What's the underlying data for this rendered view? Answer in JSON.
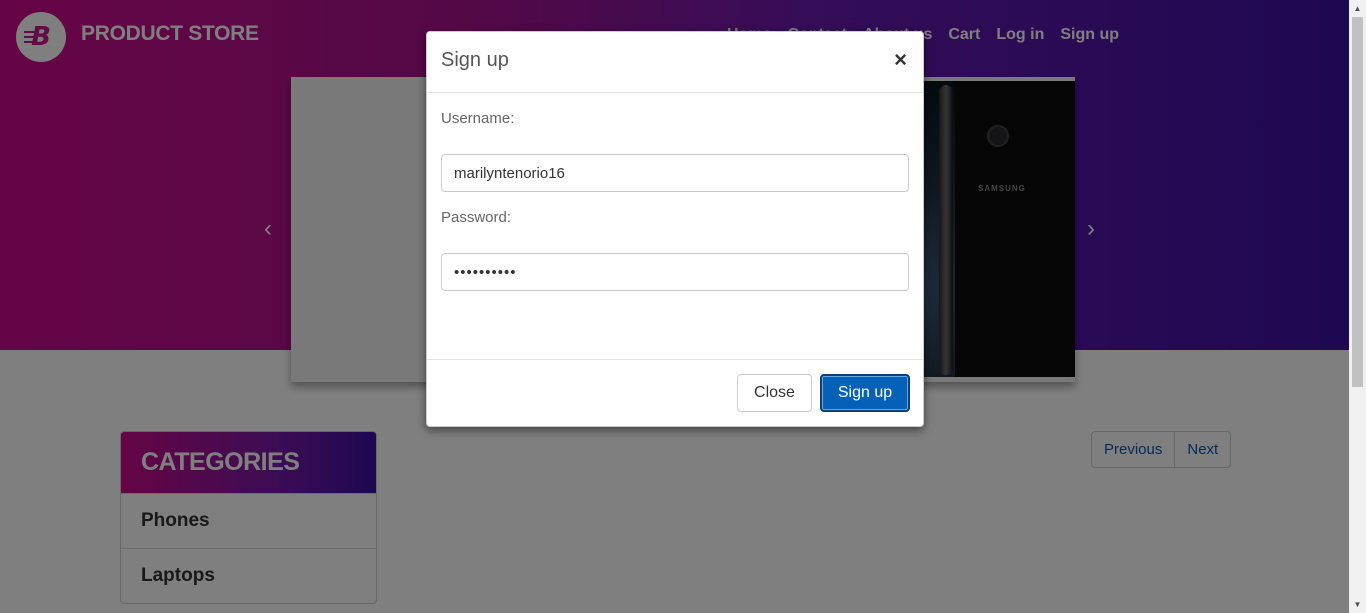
{
  "navbar": {
    "brand_name": "PRODUCT STORE",
    "brand_logo_letter": "B",
    "links": [
      "Home",
      "Contact",
      "About us",
      "Cart",
      "Log in",
      "Sign up"
    ]
  },
  "carousel": {
    "phone_brand": "SAMSUNG",
    "prev_icon": "‹",
    "next_icon": "›"
  },
  "categories": {
    "header": "CATEGORIES",
    "items": [
      "Phones",
      "Laptops"
    ]
  },
  "pagination": {
    "previous": "Previous",
    "next": "Next"
  },
  "modal": {
    "title": "Sign up",
    "close_symbol": "×",
    "username_label": "Username:",
    "username_value": "marilyntenorio16",
    "password_label": "Password:",
    "password_value": "1234567890",
    "close_button": "Close",
    "signup_button": "Sign up"
  },
  "colors": {
    "accent": "#cc0a8b",
    "secondary": "#3d10a4",
    "primary_button": "#0561b8"
  },
  "scrollbar": {
    "up_icon": "▲",
    "down_icon": "▼"
  }
}
